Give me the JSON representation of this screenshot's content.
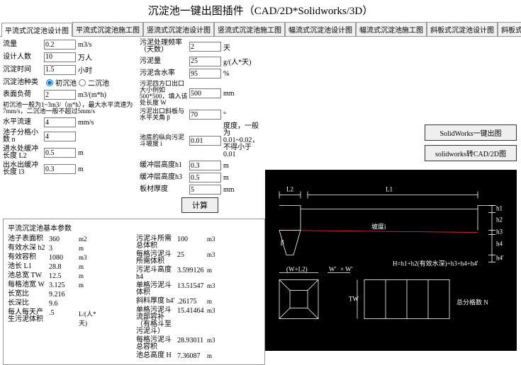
{
  "title": "沉淀池一键出图插件（CAD/2D*Solidworks/3D）",
  "tabs": [
    "平流式沉淀池设计图",
    "平流式沉淀池施工图",
    "竖流式沉淀池设计图",
    "竖流式沉淀池施工图",
    "幅流式沉淀池设计图",
    "幅流式沉淀池施工图",
    "斜板式沉淀池设计图",
    "斜板式沉淀池施工图"
  ],
  "inputs_a": {
    "flow_lbl": "流量",
    "flow_val": "0.2",
    "flow_unit": "m3/s",
    "pop_lbl": "设计人数",
    "pop_val": "10",
    "pop_unit": "万人",
    "time_lbl": "沉淀时间",
    "time_val": "1.5",
    "time_unit": "小时",
    "type_lbl": "沉淀池种类",
    "type_opt1": "初沉池",
    "type_opt2": "二沉池",
    "load_lbl": "表面负荷",
    "load_val": "2",
    "load_unit": "m3/(m*h)",
    "note1": "初沉池一般为1~3m3/（m*h），最大水平流速为7mm/s，二沉池一般不超过5mm/s",
    "hvel_lbl": "水平流速",
    "hvel_val": "4",
    "hvel_unit": "mm/s",
    "ngrid_lbl": "池子分格小数 n",
    "ngrid_val": "4",
    "l2_lbl": "进水处缓冲长度 L2",
    "l2_val": "0.5",
    "l2_unit": "m",
    "l3_lbl": "出水出缓冲长度 l3",
    "l3_val": "0.3",
    "l3_unit": "m"
  },
  "inputs_b": {
    "freq_lbl": "污泥处理频率（天数）",
    "freq_val": "2",
    "freq_unit": "天",
    "amt_lbl": "污泥量",
    "amt_val": "25",
    "amt_unit": "g/(人*天)",
    "wc_lbl": "污泥含水率",
    "wc_val": "95",
    "wc_unit": "%",
    "out_lbl": "污泥四方口出口大小例如500*500，填入该处长度 W",
    "out_val": "500",
    "out_unit": "mm",
    "ang_lbl": "污泥出口斜板与水平关角 β",
    "ang_val": "70",
    "ang_unit": "°",
    "slope_lbl": "池底的纵向污泥斗坡度 i",
    "slope_val": "0.01",
    "slope_note": "度度，一般为0.01~0.02，不得小于0.01",
    "h1_lbl": "缓冲层高度h1",
    "h1_val": "0.3",
    "h1_unit": "m",
    "h3_lbl": "缓冲层高度h3",
    "h3_val": "0.5",
    "h3_unit": "m",
    "thk_lbl": "板材厚度",
    "thk_val": "5",
    "thk_unit": "mm"
  },
  "calc_label": "计算",
  "results_title": "平流沉淀池基本参数",
  "results_a": [
    {
      "l": "池子表面积",
      "v": "360",
      "u": "m2"
    },
    {
      "l": "有效水深 h2",
      "v": "3",
      "u": "m"
    },
    {
      "l": "有效容积",
      "v": "1080",
      "u": "m3"
    },
    {
      "l": "池长 L1",
      "v": "28.8",
      "u": "m"
    },
    {
      "l": "池总宽 TW",
      "v": "12.5",
      "u": "m"
    },
    {
      "l": "每格池宽 W",
      "v": "3.125",
      "u": "m"
    },
    {
      "l": "长宽比",
      "v": "9.216",
      "u": ""
    },
    {
      "l": "长深比",
      "v": "9.6",
      "u": ""
    },
    {
      "l": "每人每天产生污泥体积",
      "v": ".5",
      "u": "L/(人*天)"
    }
  ],
  "results_b": [
    {
      "l": "污泥斗所需总体积",
      "v": "100",
      "u": "m3"
    },
    {
      "l": "每格污泥斗所需体积",
      "v": "25",
      "u": "m3"
    },
    {
      "l": "污泥斗高度 h4",
      "v": "3.599126",
      "u": "m"
    },
    {
      "l": "单格污泥斗体积",
      "v": "13.51547",
      "u": "m3"
    },
    {
      "l": "斜料厚度 h4'",
      "v": ".26175",
      "u": "m"
    },
    {
      "l": "单格污泥斗流部容补（有格斗至污泥斗）",
      "v": "15.41464",
      "u": "m3"
    },
    {
      "l": "每格污泥斗总容积",
      "v": "28.93011",
      "u": "m3"
    },
    {
      "l": "池总高度 H",
      "v": "7.36087",
      "u": "m"
    }
  ],
  "side_btns": {
    "sw": "SolidWorks一键出图",
    "cad": "solidworks转CAD/2D图"
  },
  "diag": {
    "l1": "L1",
    "l2": "L2",
    "h1": "h1",
    "h2": "h2",
    "h3": "h3",
    "h4": "h4",
    "h4p": "h4'",
    "slope": "坡度i",
    "b": "β",
    "wl2": "(W+L2)",
    "wp": "W'",
    "wpp": "× W'",
    "tw": "TW",
    "n": "总分格数 N",
    "heq": "H=h1+h2(有效水深)+h3+h4+h4'"
  }
}
